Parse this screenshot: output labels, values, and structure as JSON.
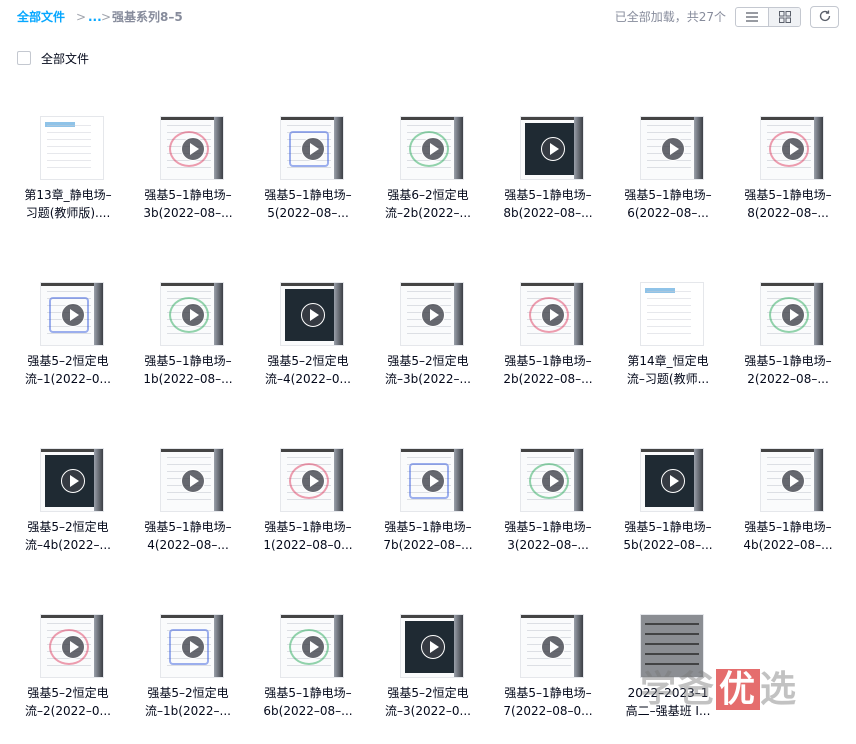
{
  "breadcrumb": {
    "root": "全部文件",
    "separator": ">",
    "ellipsis": "...",
    "current": "强基系列8–5"
  },
  "status": {
    "loaded_text": "已全部加载，共27个"
  },
  "toolbar": {
    "list_view_icon": "list-icon",
    "grid_view_icon": "grid-icon",
    "refresh_icon": "refresh-icon",
    "active_view": "grid"
  },
  "select_all": {
    "label": "全部文件"
  },
  "watermark": {
    "text_a": "学爸",
    "text_b": "优",
    "text_c": "选"
  },
  "files": [
    {
      "line1": "第13章_静电场–",
      "line2": "习题(教师版)....",
      "type": "doc"
    },
    {
      "line1": "强基5–1静电场–",
      "line2": "3b(2022–08–...",
      "type": "video"
    },
    {
      "line1": "强基5–1静电场–",
      "line2": "5(2022–08–...",
      "type": "video"
    },
    {
      "line1": "强基6–2恒定电",
      "line2": "流–2b(2022–...",
      "type": "video"
    },
    {
      "line1": "强基5–1静电场–",
      "line2": "8b(2022–08–...",
      "type": "video"
    },
    {
      "line1": "强基5–1静电场–",
      "line2": "6(2022–08–...",
      "type": "video"
    },
    {
      "line1": "强基5–1静电场–",
      "line2": "8(2022–08–...",
      "type": "video"
    },
    {
      "line1": "强基5–2恒定电",
      "line2": "流–1(2022–0...",
      "type": "video"
    },
    {
      "line1": "强基5–1静电场–",
      "line2": "1b(2022–08–...",
      "type": "video"
    },
    {
      "line1": "强基5–2恒定电",
      "line2": "流–4(2022–0...",
      "type": "video"
    },
    {
      "line1": "强基5–2恒定电",
      "line2": "流–3b(2022–...",
      "type": "video"
    },
    {
      "line1": "强基5–1静电场–",
      "line2": "2b(2022–08–...",
      "type": "video"
    },
    {
      "line1": "第14章_恒定电",
      "line2": "流–习题(教师...",
      "type": "doc"
    },
    {
      "line1": "强基5–1静电场–",
      "line2": "2(2022–08–...",
      "type": "video"
    },
    {
      "line1": "强基5–2恒定电",
      "line2": "流–4b(2022–...",
      "type": "video"
    },
    {
      "line1": "强基5–1静电场–",
      "line2": "4(2022–08–...",
      "type": "video"
    },
    {
      "line1": "强基5–1静电场–",
      "line2": "1(2022–08–0...",
      "type": "video"
    },
    {
      "line1": "强基5–1静电场–",
      "line2": "7b(2022–08–...",
      "type": "video"
    },
    {
      "line1": "强基5–1静电场–",
      "line2": "3(2022–08–...",
      "type": "video"
    },
    {
      "line1": "强基5–1静电场–",
      "line2": "5b(2022–08–...",
      "type": "video"
    },
    {
      "line1": "强基5–1静电场–",
      "line2": "4b(2022–08–...",
      "type": "video"
    },
    {
      "line1": "强基5–2恒定电",
      "line2": "流–2(2022–0...",
      "type": "video"
    },
    {
      "line1": "强基5–2恒定电",
      "line2": "流–1b(2022–...",
      "type": "video"
    },
    {
      "line1": "强基5–1静电场–",
      "line2": "6b(2022–08–...",
      "type": "video"
    },
    {
      "line1": "强基5–2恒定电",
      "line2": "流–3(2022–0...",
      "type": "video"
    },
    {
      "line1": "强基5–1静电场–",
      "line2": "7(2022–08–0...",
      "type": "video"
    },
    {
      "line1": "2022–2023–1",
      "line2": "高二–强基班 I...",
      "type": "doc-dark"
    }
  ]
}
